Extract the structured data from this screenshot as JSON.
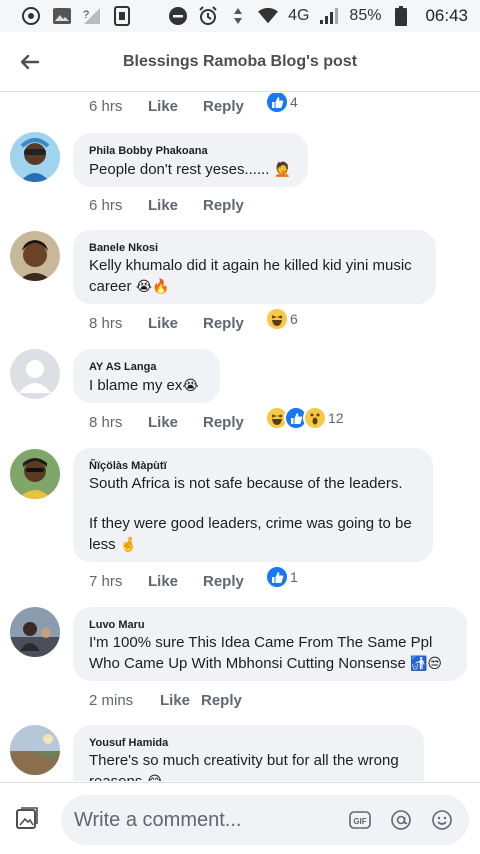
{
  "status_bar": {
    "network": "4G",
    "battery": "85%",
    "time": "06:43"
  },
  "header": {
    "title": "Blessings Ramoba Blog's post"
  },
  "actions": {
    "like": "Like",
    "reply": "Reply"
  },
  "top_meta": {
    "time": "6 hrs",
    "reaction_count": "4"
  },
  "comments": [
    {
      "author": "Phila Bobby Phakoana",
      "text": "People don't rest yeses......",
      "emoji": "🤦",
      "time": "6 hrs",
      "reaction_count": ""
    },
    {
      "author": "Banele Nkosi",
      "text": "Kelly khumalo did it again he killed kid yini music career",
      "emoji": "😭🔥",
      "time": "8 hrs",
      "reaction_count": "6"
    },
    {
      "author": "AY AS Langa",
      "text": "I blame my ex",
      "emoji": "😭",
      "time": "8 hrs",
      "reaction_count": "12"
    },
    {
      "author": "Ñïçölàs Màpùtï",
      "text": "South Africa is not safe because of the leaders.\n\nIf they were good leaders, crime was going to be less",
      "emoji": "🤞",
      "time": "7 hrs",
      "reaction_count": "1"
    },
    {
      "author": "Luvo Maru",
      "text": "I'm 100% sure This Idea Came From The Same Ppl Who Came Up With Mbhonsi Cutting Nonsense",
      "emoji": "🚮😒",
      "time": "2 mins",
      "reaction_count": ""
    },
    {
      "author": "Yousuf Hamida",
      "text": "There's so much creativity but for all the wrong reasons",
      "emoji": "😂",
      "time": "",
      "reaction_count": ""
    }
  ],
  "composer": {
    "placeholder": "Write a comment..."
  },
  "colors": {
    "like_blue": "#1877f2",
    "bubble_bg": "#f0f2f5",
    "meta_gray": "#606770",
    "reaction_yellow": "#f7c84a"
  }
}
